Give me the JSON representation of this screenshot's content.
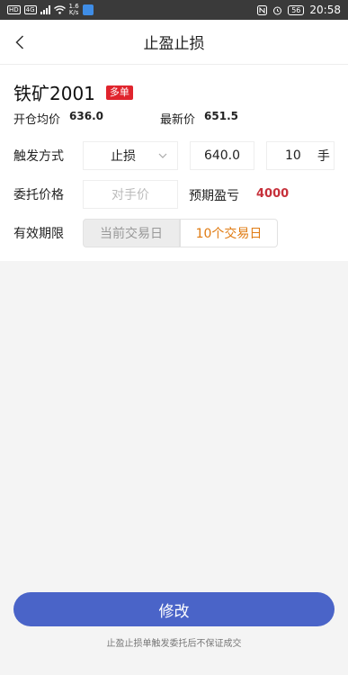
{
  "status_bar": {
    "hd_label": "HD",
    "signal_label": "4G",
    "speed_value": "1.6",
    "speed_unit": "K/s",
    "battery": "56",
    "time": "20:58"
  },
  "nav": {
    "title": "止盈止损"
  },
  "instrument": {
    "name": "铁矿2001",
    "direction_badge": "多单",
    "badge_color": "#e0242d"
  },
  "prices": {
    "open_avg_label": "开仓均价",
    "open_avg_value": "636.0",
    "last_label": "最新价",
    "last_value": "651.5"
  },
  "trigger": {
    "label": "触发方式",
    "mode": "止损",
    "price": "640.0",
    "quantity": "10",
    "quantity_unit": "手"
  },
  "order_price": {
    "label": "委托价格",
    "placeholder": "对手价",
    "expected_pnl_label": "预期盈亏",
    "expected_pnl_value": "4000",
    "pnl_color": "#c6303a"
  },
  "validity": {
    "label": "有效期限",
    "option_current": "当前交易日",
    "option_ten": "10个交易日",
    "selected": "10个交易日",
    "selected_color": "#e07b12"
  },
  "submit": {
    "label": "修改",
    "color": "#4a64c8"
  },
  "footnote": "止盈止损单触发委托后不保证成交"
}
